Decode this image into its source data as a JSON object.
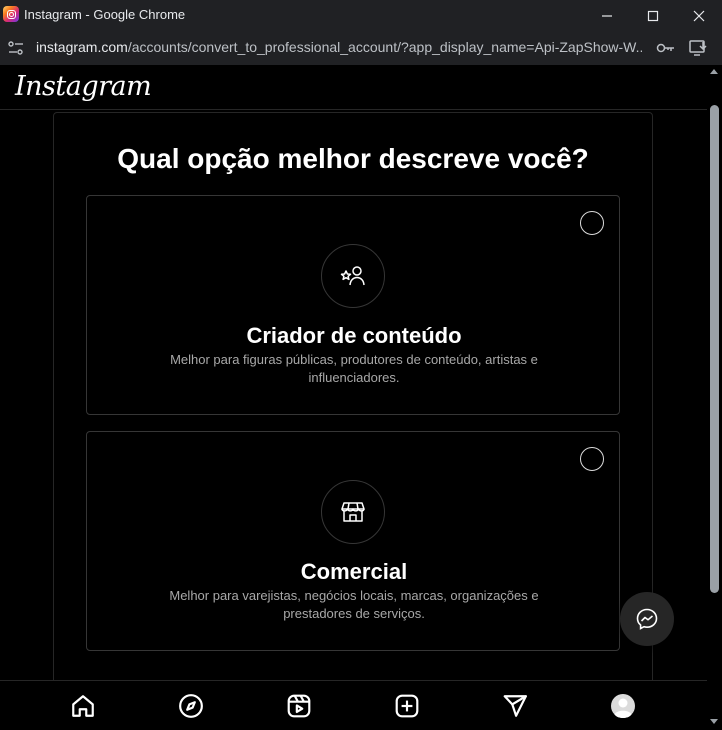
{
  "window": {
    "title": "Instagram - Google Chrome"
  },
  "address_bar": {
    "url_host": "instagram.com",
    "url_path": "/accounts/convert_to_professional_account/?app_display_name=Api-ZapShow-W..."
  },
  "header": {
    "logo_text": "Instagram"
  },
  "main": {
    "title": "Qual opção melhor descreve você?",
    "options": [
      {
        "title": "Criador de conteúdo",
        "description": "Melhor para figuras públicas, produtores de conteúdo, artistas e influenciadores.",
        "icon": "creator-icon",
        "selected": false
      },
      {
        "title": "Comercial",
        "description": "Melhor para varejistas, negócios locais, marcas, organizações e prestadores de serviços.",
        "icon": "storefront-icon",
        "selected": false
      }
    ]
  },
  "bottom_nav": {
    "items": [
      "home-icon",
      "explore-icon",
      "reels-icon",
      "create-icon",
      "direct-icon",
      "profile-avatar"
    ]
  },
  "colors": {
    "background": "#000000",
    "chrome_bar": "#202124",
    "border": "#363636",
    "secondary_text": "#a8a8a8"
  }
}
